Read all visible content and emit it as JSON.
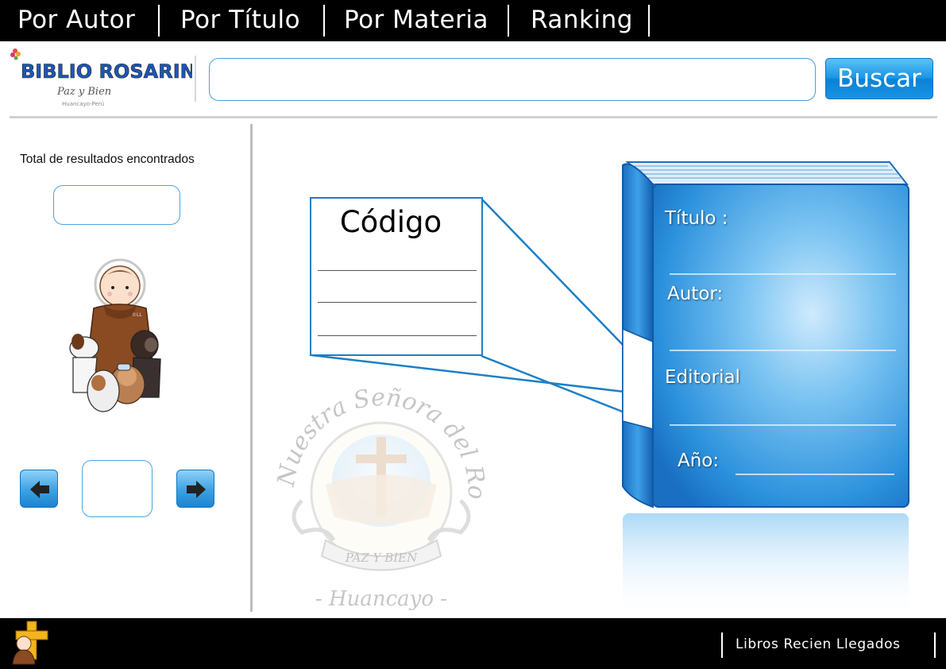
{
  "nav": {
    "items": [
      "Por Autor",
      "Por Título",
      "Por Materia",
      "Ranking"
    ]
  },
  "logo": {
    "title": "BIBLIO ROSARINA",
    "tagline": "Paz y Bien",
    "location": "Huancayo-Perú"
  },
  "search": {
    "value": "",
    "button_label": "Buscar"
  },
  "sidebar": {
    "total_label": "Total de resultados encontrados",
    "total_value": "",
    "page_value": "",
    "prev_icon": "arrow-left-icon",
    "next_icon": "arrow-right-icon"
  },
  "code_card": {
    "title": "Código"
  },
  "book": {
    "fields": [
      "Título :",
      "Autor:",
      "Editorial",
      "Año:"
    ]
  },
  "watermark": {
    "arc_text": "Nuestra Señora del Rosario",
    "motto": "PAZ Y BIEN",
    "city": "- Huancayo -"
  },
  "footer": {
    "link_label": "Libros Recien Llegados"
  },
  "colors": {
    "bar": "#000000",
    "accent": "#1b7fc6",
    "button": "#1b95e4"
  }
}
